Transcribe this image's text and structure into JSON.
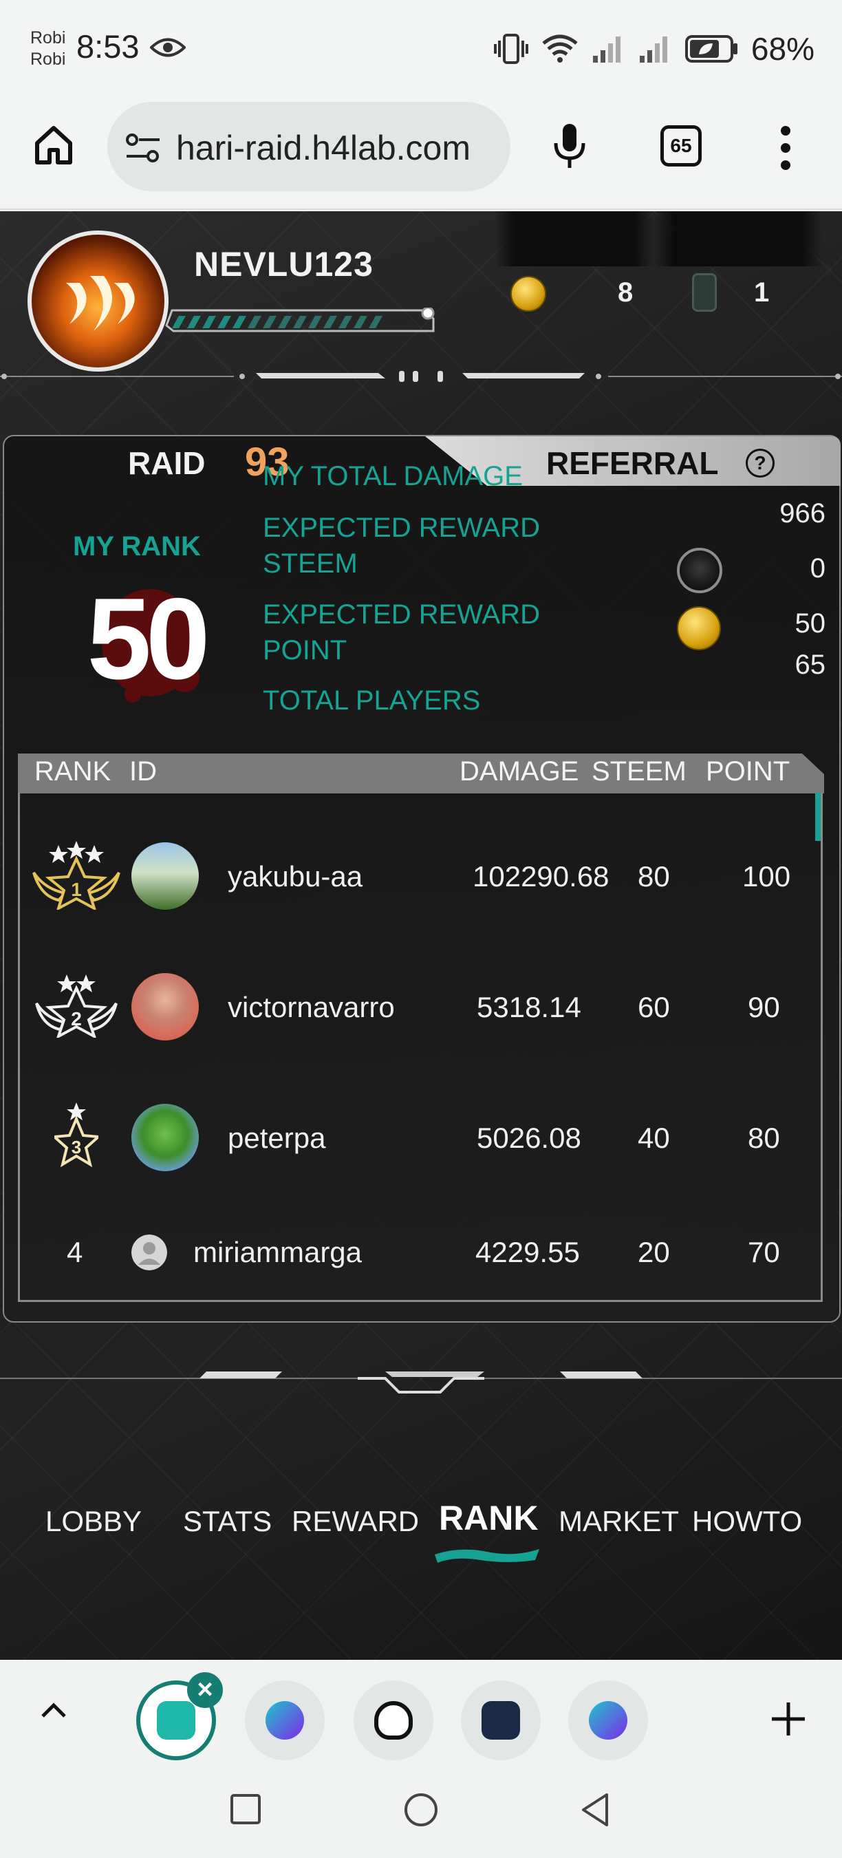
{
  "status_bar": {
    "carrier_line1": "Robi",
    "carrier_line2": "Robi",
    "time": "8:53",
    "battery": "68%"
  },
  "browser": {
    "url": "hari-raid.h4lab.com",
    "tab_count": "65"
  },
  "player": {
    "name": "NEVLU123",
    "xp_progress": 0.82,
    "coins": "8",
    "tickets": "1"
  },
  "tabs": {
    "raid_label": "RAID",
    "raid_number": "93",
    "referral_label": "REFERRAL",
    "help": "?"
  },
  "my_stats": {
    "rank_label": "MY RANK",
    "rank": "50",
    "total_damage_label": "MY TOTAL DAMAGE",
    "total_damage": "966",
    "reward_steem_label_1": "EXPECTED REWARD",
    "reward_steem_label_2": "STEEM",
    "reward_steem": "0",
    "reward_point_label_1": "EXPECTED REWARD",
    "reward_point_label_2": "POINT",
    "reward_point": "50",
    "total_players_label": "TOTAL PLAYERS",
    "total_players": "65"
  },
  "table": {
    "headers": {
      "rank": "RANK",
      "id": "ID",
      "damage": "DAMAGE",
      "steem": "STEEM",
      "point": "POINT"
    },
    "rows": [
      {
        "rank": "1",
        "id": "yakubu-aa",
        "damage": "102290.68",
        "steem": "80",
        "point": "100"
      },
      {
        "rank": "2",
        "id": "victornavarro",
        "damage": "5318.14",
        "steem": "60",
        "point": "90"
      },
      {
        "rank": "3",
        "id": "peterpa",
        "damage": "5026.08",
        "steem": "40",
        "point": "80"
      },
      {
        "rank": "4",
        "id": "miriammarga",
        "damage": "4229.55",
        "steem": "20",
        "point": "70"
      }
    ]
  },
  "game_nav": {
    "lobby": "LOBBY",
    "stats": "STATS",
    "reward": "REWARD",
    "rank": "RANK",
    "market": "MARKET",
    "howto": "HOWTO"
  },
  "colors": {
    "accent_teal": "#16a393",
    "raid_orange": "#f0a35c",
    "tab_active": "#157d74"
  }
}
